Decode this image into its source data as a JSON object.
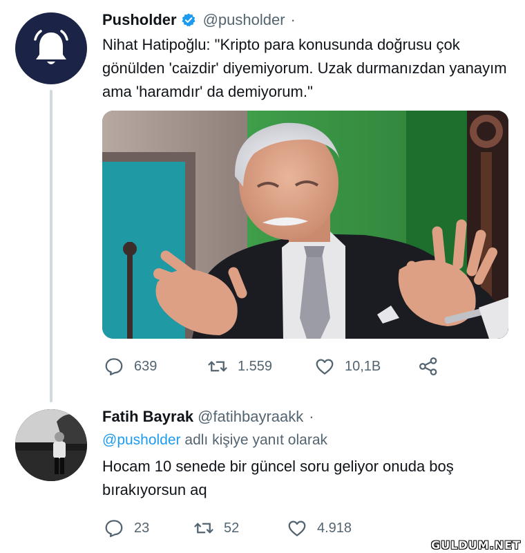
{
  "tweets": [
    {
      "author_name": "Pusholder",
      "handle": "@pusholder",
      "dot": "·",
      "avatar_icon": "bell-icon",
      "verified": true,
      "text": "Nihat Hatipoğlu: \"Kripto para konusunda doğrusu çok gönülden 'caizdir' diyemiyorum. Uzak durmanızdan yanayım ama 'haramdır' da demiyorum.\"",
      "stats": {
        "replies": "639",
        "retweets": "1.559",
        "likes": "10,1B"
      }
    },
    {
      "author_name": "Fatih Bayrak",
      "handle": "@fatihbayraakk",
      "dot": "·",
      "reply_to_mention": "@pusholder",
      "reply_to_suffix": "adlı kişiye yanıt olarak",
      "text": "Hocam 10 senede bir güncel soru geliyor onuda boş bırakıyorsun aq",
      "stats": {
        "replies": "23",
        "retweets": "52",
        "likes": "4.918"
      }
    }
  ],
  "watermark": "GULDUM.NET",
  "colors": {
    "accent": "#1d9bf0",
    "secondary_text": "#536471",
    "avatar_bg": "#1b2447"
  }
}
